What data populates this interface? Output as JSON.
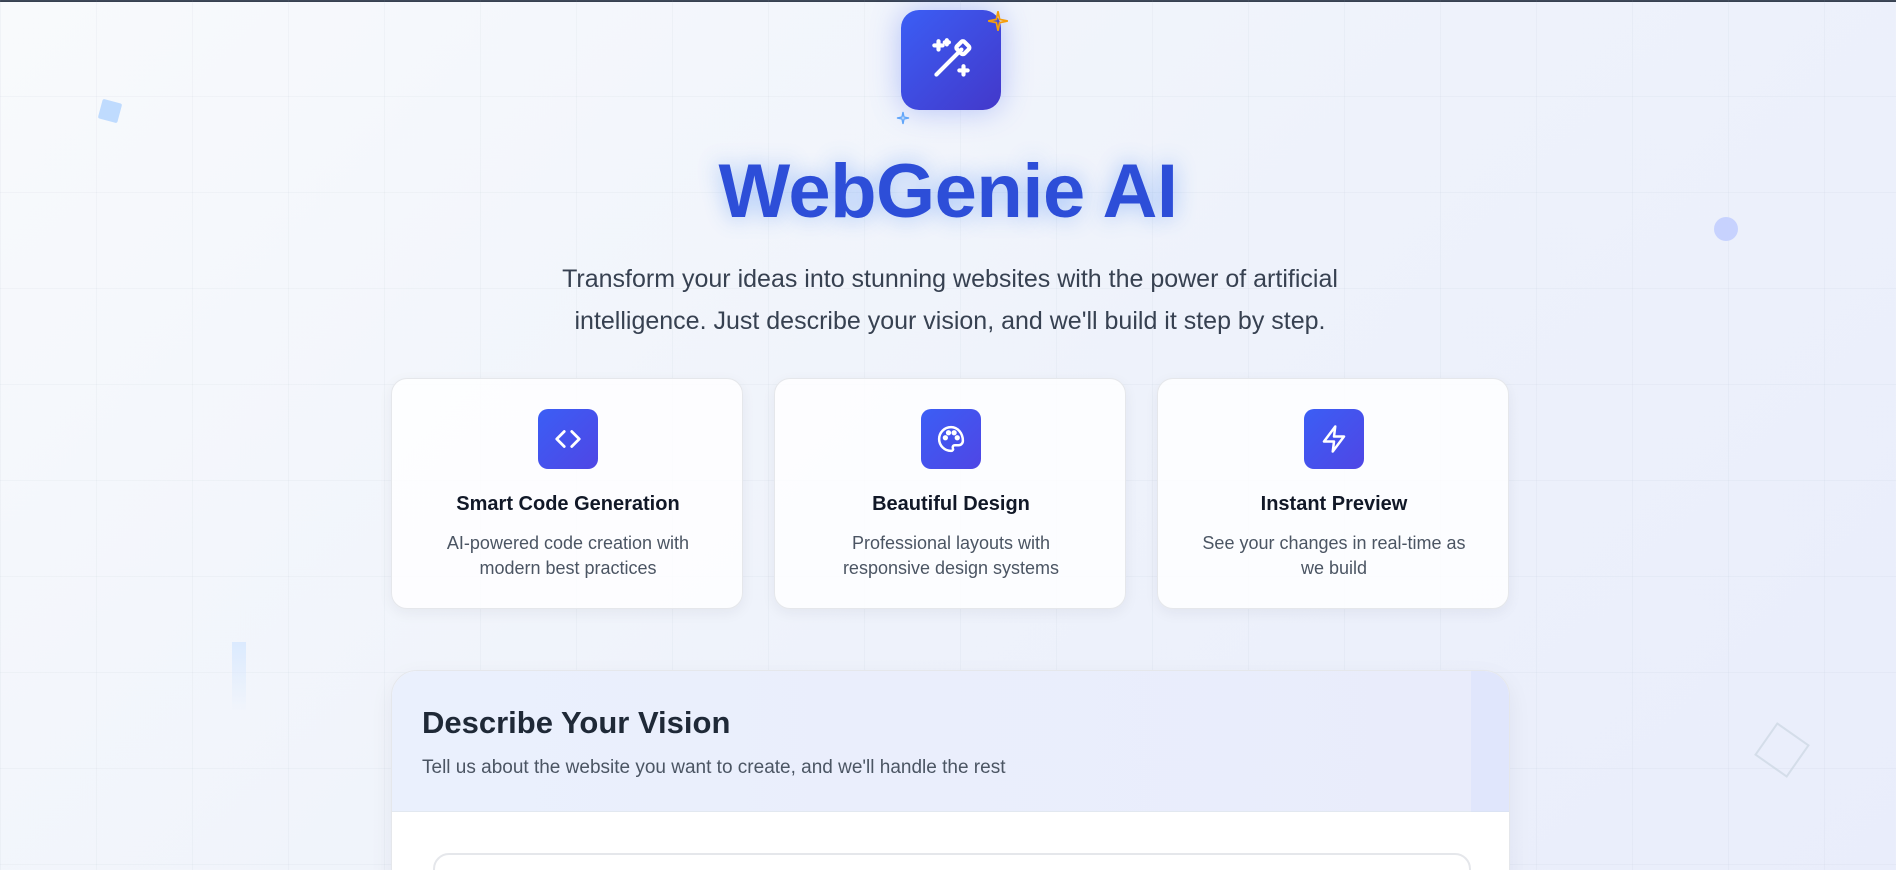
{
  "app": {
    "title": "WebGenie AI",
    "subtitle": "Transform your ideas into stunning websites with the power of artificial intelligence. Just describe your vision, and we'll build it step by step.",
    "logo_icon": "magic-wand-icon",
    "brand_color": "#2d4ed8",
    "accent_gradient": [
      "#3b5ef5",
      "#4338ca"
    ]
  },
  "features": [
    {
      "icon": "code-icon",
      "title": "Smart Code Generation",
      "description": "AI-powered code creation with modern best practices"
    },
    {
      "icon": "palette-icon",
      "title": "Beautiful Design",
      "description": "Professional layouts with responsive design systems"
    },
    {
      "icon": "lightning-icon",
      "title": "Instant Preview",
      "description": "See your changes in real-time as we build"
    }
  ],
  "vision_panel": {
    "title": "Describe Your Vision",
    "subtitle": "Tell us about the website you want to create, and we'll handle the rest"
  }
}
